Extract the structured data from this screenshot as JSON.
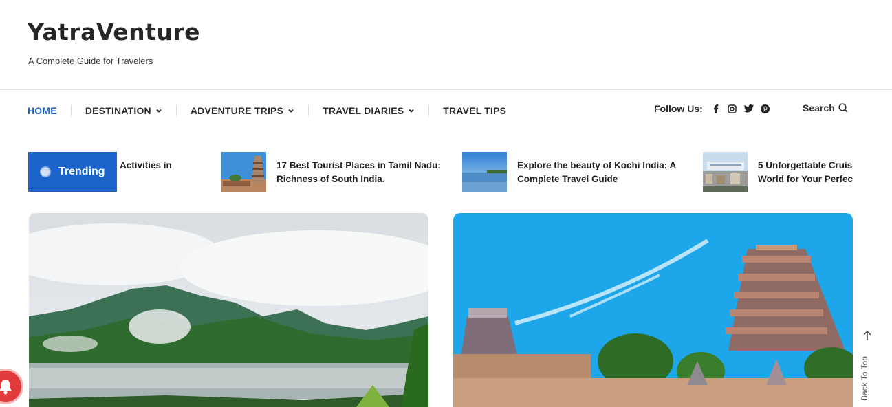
{
  "header": {
    "site_title": "YatraVenture",
    "tagline": "A Complete Guide for Travelers"
  },
  "nav": {
    "items": [
      {
        "label": "HOME",
        "active": true
      },
      {
        "label": "DESTINATION",
        "dropdown": true
      },
      {
        "label": "ADVENTURE TRIPS",
        "dropdown": true
      },
      {
        "label": "TRAVEL DIARIES",
        "dropdown": true
      },
      {
        "label": "TRAVEL TIPS"
      }
    ],
    "follow_label": "Follow Us:",
    "social_icons": [
      "facebook-icon",
      "instagram-icon",
      "twitter-icon",
      "pinterest-icon"
    ],
    "search_label": "Search"
  },
  "trending": {
    "label": "Trending",
    "items": [
      {
        "line1": "Activities in",
        "line2": ""
      },
      {
        "line1": "17 Best Tourist Places in Tamil Nadu:",
        "line2": "Richness of South India."
      },
      {
        "line1": "Explore the beauty of Kochi India: A",
        "line2": "Complete Travel Guide"
      },
      {
        "line1": "5 Unforgettable Cruis",
        "line2": "World for Your Perfec"
      }
    ]
  },
  "back_to_top": "Back To Top",
  "colors": {
    "accent": "#1b63c9",
    "notification": "#e13a3a"
  }
}
